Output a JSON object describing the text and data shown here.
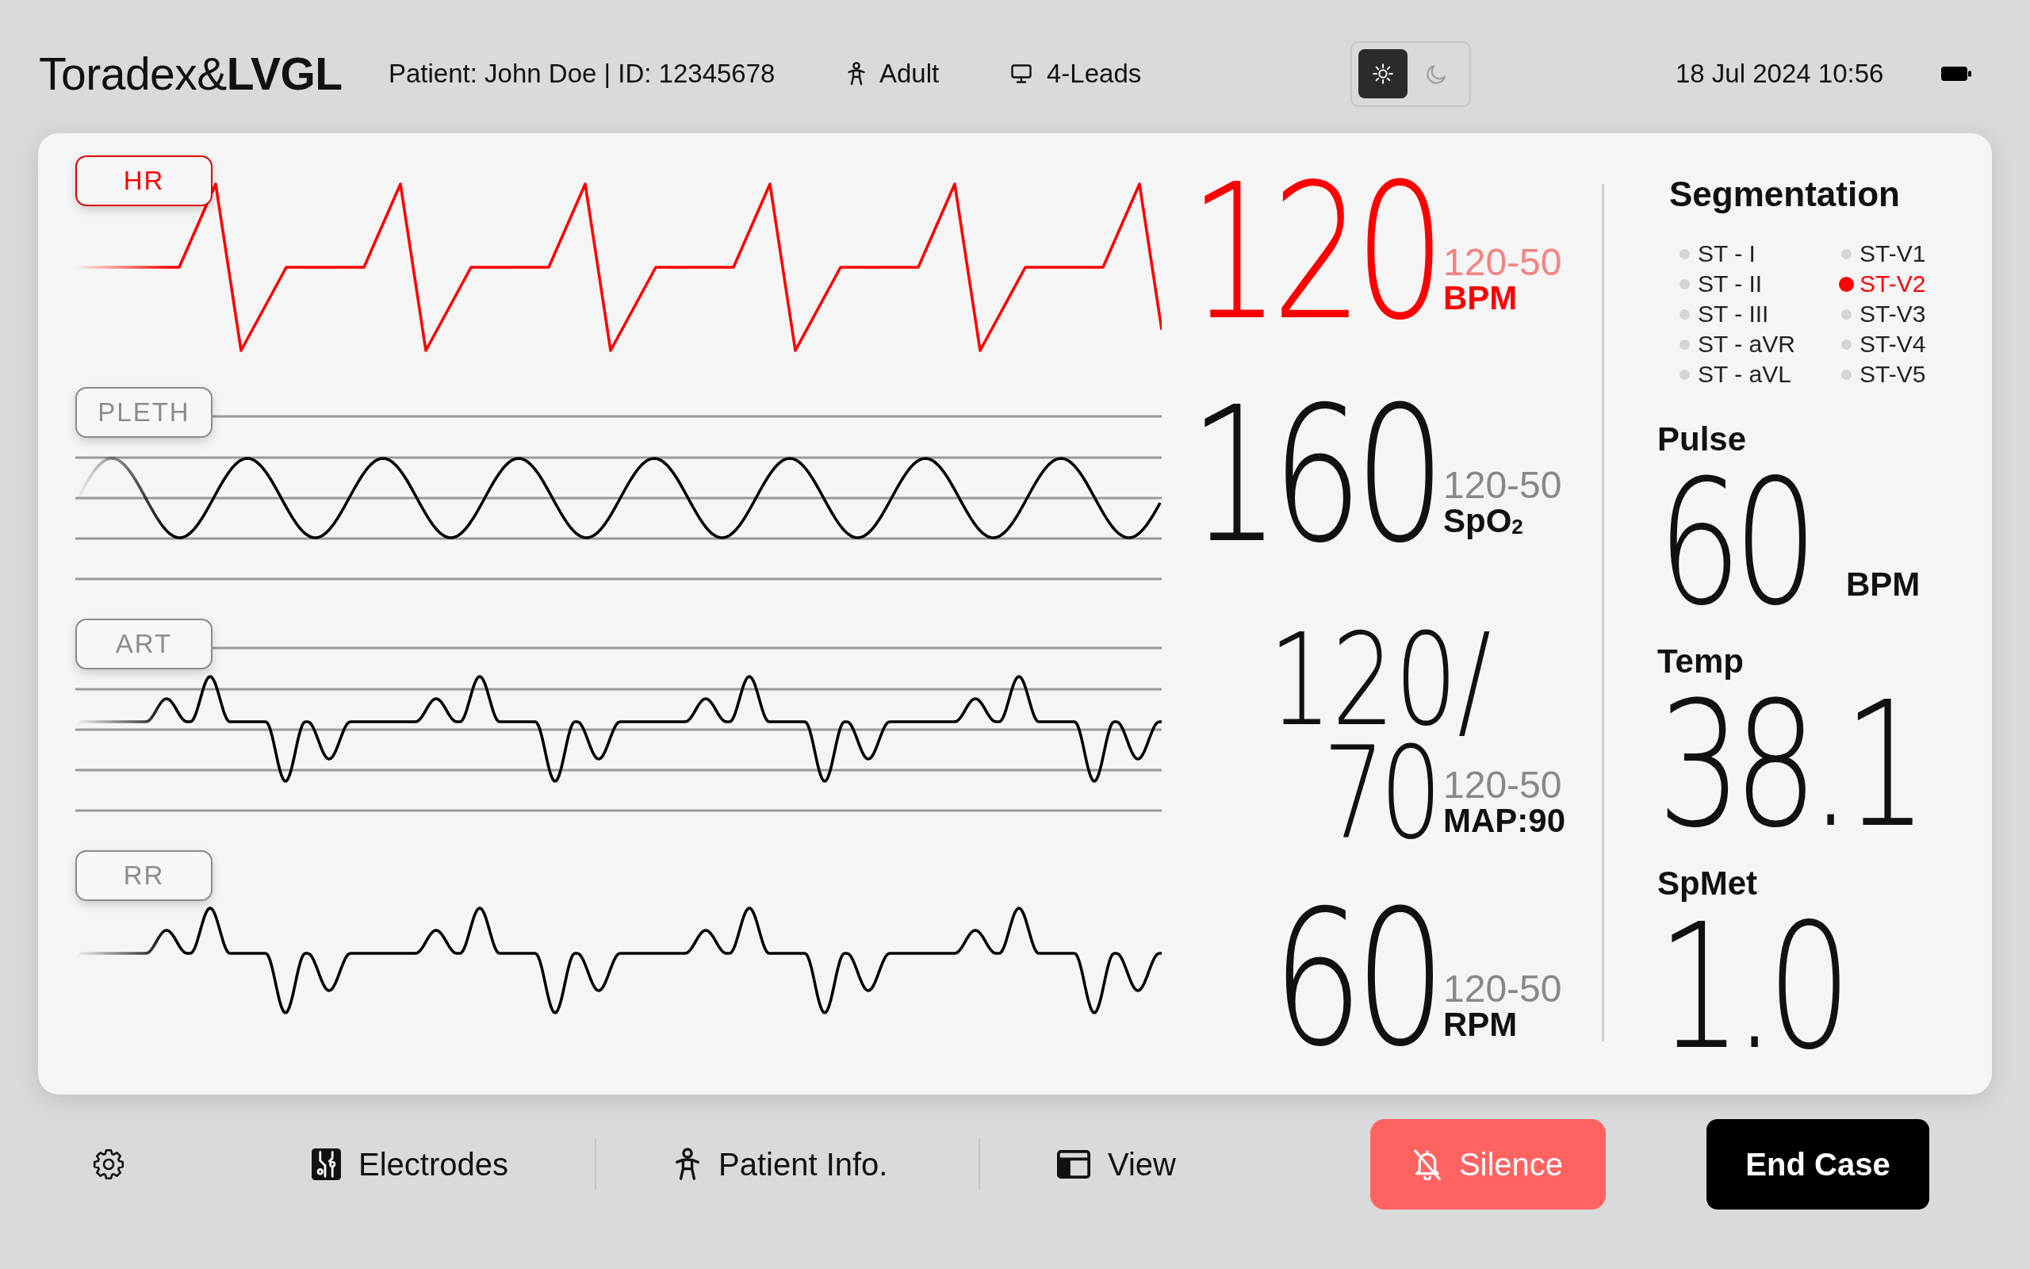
{
  "header": {
    "logo": "Toradex&**LVGL**",
    "patient": "Patient: John Doe | ID: 12345678",
    "patient_type": "Adult",
    "leads": "4-Leads",
    "theme_modes": [
      {
        "kind": "light",
        "selected": true
      },
      {
        "kind": "dark",
        "selected": false
      }
    ],
    "datetime": "18 Jul 2024 10:56"
  },
  "channels": [
    {
      "label": "HR",
      "kind": "sawtooth",
      "grid": false,
      "alarm": true,
      "value": [
        "120"
      ],
      "range": "120-50",
      "unit": "BPM"
    },
    {
      "label": "PLETH",
      "kind": "sine",
      "grid": true,
      "alarm": false,
      "value": [
        "160"
      ],
      "range": "120-50",
      "unit": "SpO$_{2}$"
    },
    {
      "label": "ART",
      "kind": "pulse",
      "grid": true,
      "alarm": false,
      "value": [
        "120/",
        "70"
      ],
      "range": "120-50",
      "unit": "MAP:90"
    },
    {
      "label": "RR",
      "kind": "pulse",
      "grid": false,
      "alarm": false,
      "value": [
        "60"
      ],
      "range": "120-50",
      "unit": "RPM"
    }
  ],
  "segmentation": {
    "title": "Segmentation",
    "columns": [
      {
        "leads": [
          {
            "label": "ST - I",
            "selected": false
          },
          {
            "label": "ST - II",
            "selected": false
          },
          {
            "label": "ST - III",
            "selected": false
          },
          {
            "label": "ST - aVR",
            "selected": false
          },
          {
            "label": "ST - aVL",
            "selected": false
          }
        ]
      },
      {
        "leads": [
          {
            "label": "ST-V1",
            "selected": false
          },
          {
            "label": "ST-V2",
            "selected": true
          },
          {
            "label": "ST-V3",
            "selected": false
          },
          {
            "label": "ST-V4",
            "selected": false
          },
          {
            "label": "ST-V5",
            "selected": false
          }
        ]
      }
    ]
  },
  "vitals": [
    {
      "label": "Pulse",
      "value": "60",
      "unit": "BPM"
    },
    {
      "label": "Temp",
      "value": "38.1"
    },
    {
      "label": "SpMet",
      "value": "1.0"
    }
  ],
  "toolbar": [
    {
      "kind": "settings"
    },
    {
      "kind": "electrodes",
      "label": "Electrodes"
    },
    {
      "kind": "patient",
      "label": "Patient Info."
    },
    {
      "kind": "view",
      "label": "View"
    }
  ],
  "silence_button": {
    "label": "Silence"
  },
  "end_case_button": {
    "label": "End Case"
  }
}
